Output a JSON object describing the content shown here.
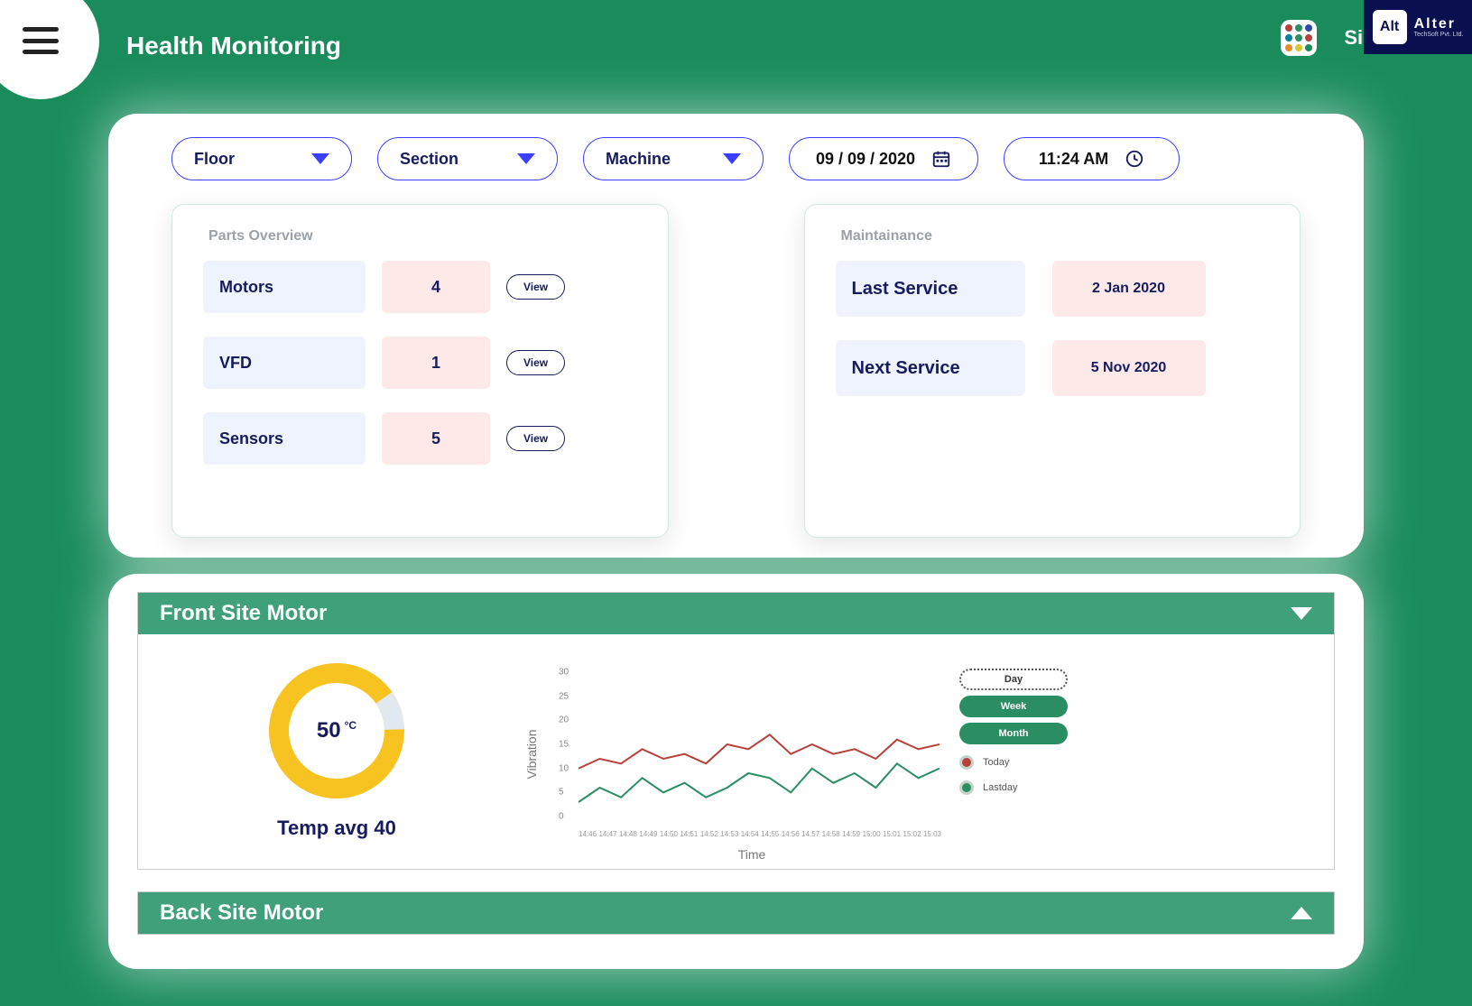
{
  "header": {
    "title": "Health Monitoring",
    "sign_out": "Sign Out",
    "logo_alt": "Alt",
    "logo_name": "Alter",
    "logo_sub": "TechSoft Pvt. Ltd."
  },
  "filters": {
    "floor": "Floor",
    "section": "Section",
    "machine": "Machine",
    "date": "09 / 09 / 2020",
    "time": "11:24 AM"
  },
  "parts": {
    "heading": "Parts Overview",
    "view": "View",
    "rows": [
      {
        "label": "Motors",
        "count": "4"
      },
      {
        "label": "VFD",
        "count": "1"
      },
      {
        "label": "Sensors",
        "count": "5"
      }
    ]
  },
  "maint": {
    "heading": "Maintainance",
    "rows": [
      {
        "label": "Last Service",
        "value": "2 Jan 2020"
      },
      {
        "label": "Next Service",
        "value": "5 Nov 2020"
      }
    ]
  },
  "motors": {
    "front_title": "Front Site Motor",
    "back_title": "Back Site Motor",
    "gauge": {
      "value": "50",
      "unit": "°C",
      "avg": "Temp avg 40"
    },
    "chart": {
      "xlabel": "Time",
      "ylabel": "Vibration",
      "scope": {
        "day": "Day",
        "week": "Week",
        "month": "Month"
      },
      "legend": {
        "today": "Today",
        "lastday": "Lastday"
      }
    }
  },
  "chart_data": {
    "type": "line",
    "xlabel": "Time",
    "ylabel": "Vibration",
    "ylim": [
      0,
      30
    ],
    "yticks": [
      0,
      5,
      10,
      15,
      20,
      25,
      30
    ],
    "categories": [
      "14:46",
      "14:47",
      "14:48",
      "14:49",
      "14:50",
      "14:51",
      "14:52",
      "14:53",
      "14:54",
      "14:55",
      "14:56",
      "14:57",
      "14:58",
      "14:59",
      "15:00",
      "15:01",
      "15:02",
      "15:03"
    ],
    "series": [
      {
        "name": "Today",
        "color": "#b7413a",
        "values": [
          10,
          12,
          11,
          14,
          12,
          13,
          11,
          15,
          14,
          17,
          13,
          15,
          13,
          14,
          12,
          16,
          14,
          15
        ]
      },
      {
        "name": "Lastday",
        "color": "#2b8e63",
        "values": [
          3,
          6,
          4,
          8,
          5,
          7,
          4,
          6,
          9,
          8,
          5,
          10,
          7,
          9,
          6,
          11,
          8,
          10
        ]
      }
    ]
  }
}
